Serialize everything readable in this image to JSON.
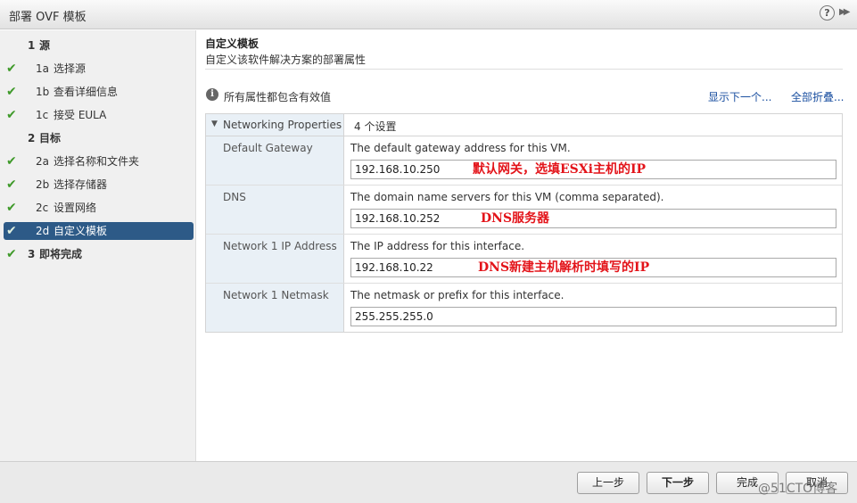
{
  "window": {
    "title": "部署 OVF 模板",
    "help_label": "?",
    "expand_label": "▶▶"
  },
  "sidebar": {
    "steps": [
      {
        "num": "1",
        "label": "源",
        "group": true,
        "done": false
      },
      {
        "num": "1a",
        "label": "选择源",
        "done": true
      },
      {
        "num": "1b",
        "label": "查看详细信息",
        "done": true
      },
      {
        "num": "1c",
        "label": "接受 EULA",
        "done": true
      },
      {
        "num": "2",
        "label": "目标",
        "group": true,
        "done": false
      },
      {
        "num": "2a",
        "label": "选择名称和文件夹",
        "done": true
      },
      {
        "num": "2b",
        "label": "选择存储器",
        "done": true
      },
      {
        "num": "2c",
        "label": "设置网络",
        "done": true
      },
      {
        "num": "2d",
        "label": "自定义模板",
        "done": true,
        "active": true
      },
      {
        "num": "3",
        "label": "即将完成",
        "group": true,
        "done": true
      }
    ],
    "check_glyph": "✔"
  },
  "main": {
    "title": "自定义模板",
    "subtitle": "自定义该软件解决方案的部署属性",
    "info_text": "所有属性都包含有效值",
    "show_next_link": "显示下一个...",
    "collapse_all_link": "全部折叠...",
    "section": {
      "label": "Networking Properties",
      "count": "4 个设置"
    },
    "properties": [
      {
        "label": "Default Gateway",
        "description": "The default gateway address for this VM.",
        "value": "192.168.10.250",
        "annotation": "默认网关，选填ESXi主机的IP"
      },
      {
        "label": "DNS",
        "description": "The domain name servers for this VM (comma separated).",
        "value": "192.168.10.252",
        "annotation": "DNS服务器"
      },
      {
        "label": "Network 1 IP Address",
        "description": "The IP address for this interface.",
        "value": "192.168.10.22",
        "annotation": "DNS新建主机解析时填写的IP"
      },
      {
        "label": "Network 1 Netmask",
        "description": "The netmask or prefix for this interface.",
        "value": "255.255.255.0",
        "annotation": ""
      }
    ]
  },
  "footer": {
    "back_label": "上一步",
    "next_label": "下一步",
    "finish_label": "完成",
    "cancel_label": "取消",
    "watermark": "@51CTO博客"
  },
  "colors": {
    "accent": "#2d5a87",
    "check": "#3f9a2a",
    "annotation": "#e3141a",
    "link": "#1a4fa0"
  }
}
